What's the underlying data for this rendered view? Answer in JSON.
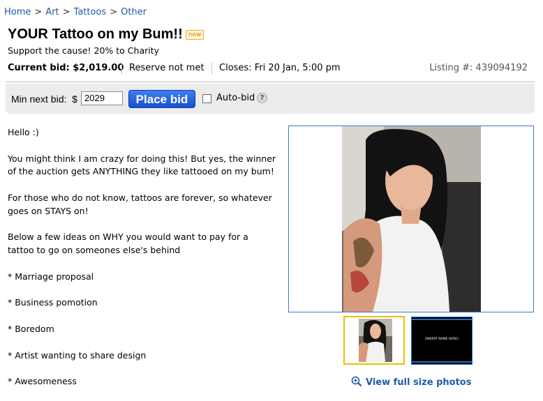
{
  "breadcrumb": {
    "items": [
      "Home",
      "Art",
      "Tattoos",
      "Other"
    ],
    "separator": ">"
  },
  "listing": {
    "title": "YOUR Tattoo on my Bum!!",
    "badge": "new",
    "subtitle": "Support the cause! 20% to Charity",
    "current_bid": "Current bid: $2,019.00",
    "reserve": "Reserve not met",
    "closes": "Closes: Fri 20 Jan, 5:00 pm",
    "listing_number": "Listing #: 439094192"
  },
  "bid_bar": {
    "min_next_label": "Min next bid:",
    "currency": "$",
    "bid_value": "2029",
    "place_bid_label": "Place bid",
    "auto_bid_label": "Auto-bid",
    "help_icon": "?"
  },
  "description": [
    "Hello :)",
    "You might think I am crazy for doing this! But yes, the winner of the auction gets ANYTHING they like tattooed on my bum!",
    "For those who do not know, tattoos are forever, so whatever goes on STAYS on!",
    "Below a few ideas on WHY you would want to pay for a tattoo to go on someones else's behind",
    "* Marriage proposal",
    "* Business pomotion",
    "* Boredom",
    "* Artist wanting to share design",
    "* Awesomeness"
  ],
  "photos": {
    "thumb2_text": "[INSERT NAME HERE]",
    "view_full_label": "View full size photos"
  },
  "colors": {
    "link": "#1f5ba6",
    "button": "#1a4fd0",
    "selected_thumb": "#e8c200",
    "badge": "#e07b00"
  }
}
